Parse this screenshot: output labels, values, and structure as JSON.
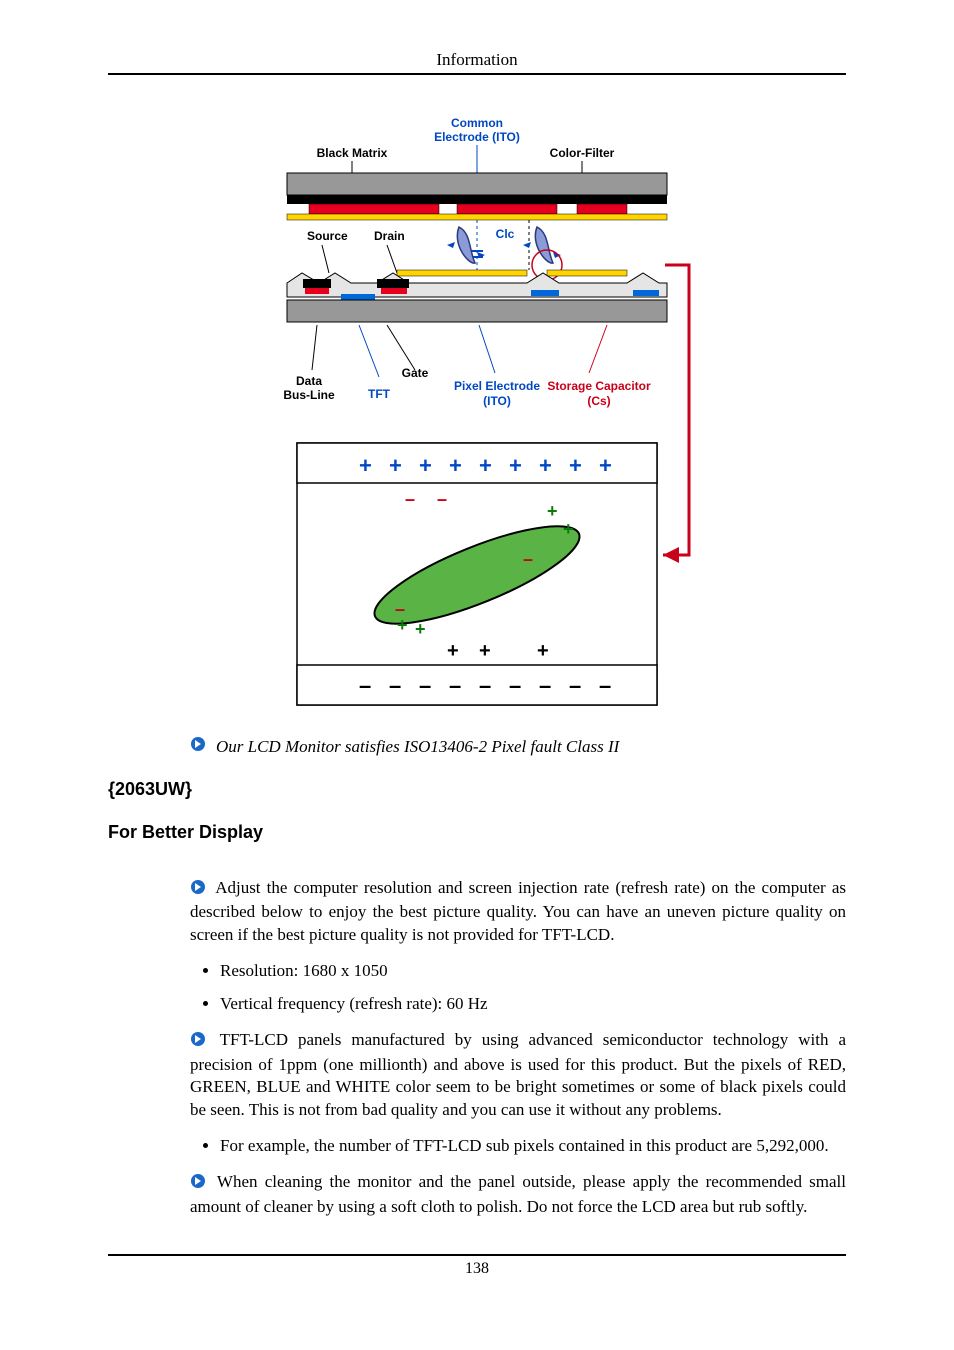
{
  "header": {
    "title": "Information"
  },
  "diagram": {
    "labels": {
      "common_electrode_1": "Common",
      "common_electrode_2": "Electrode (ITO)",
      "black_matrix": "Black Matrix",
      "color_filter": "Color-Filter",
      "source": "Source",
      "drain": "Drain",
      "clc": "Clc",
      "data_bus_1": "Data",
      "data_bus_2": "Bus-Line",
      "gate": "Gate",
      "tft": "TFT",
      "pixel_electrode_1": "Pixel Electrode",
      "pixel_electrode_2": "(ITO)",
      "storage_cap_1": "Storage Capacitor",
      "storage_cap_2": "(Cs)"
    }
  },
  "iso_note": "Our LCD Monitor satisfies ISO13406-2 Pixel fault Class II",
  "model_heading": "{2063UW}",
  "section_heading": "For Better Display",
  "paragraphs": {
    "p1": "Adjust the computer resolution and screen injection rate (refresh rate) on the computer as described below to enjoy the best picture quality. You can have an uneven picture quality on screen if the best picture quality is not provided for TFT-LCD.",
    "p2": "TFT-LCD panels manufactured by using advanced semiconductor technology with a precision of 1ppm (one millionth) and above is used for this product. But the pixels of RED, GREEN, BLUE and WHITE color seem to be bright sometimes or some of black pixels could be seen. This is not from bad quality and you can use it without any problems.",
    "p3": "When cleaning the monitor and the panel outside, please apply the recommended small amount of cleaner by using a soft cloth to polish. Do not force the LCD area but rub softly."
  },
  "bullets": {
    "b1": "Resolution: 1680 x 1050",
    "b2": "Vertical frequency (refresh rate): 60 Hz",
    "b3": "For example, the number of TFT-LCD sub pixels contained in this product are 5,292,000."
  },
  "footer": {
    "page_number": "138"
  }
}
